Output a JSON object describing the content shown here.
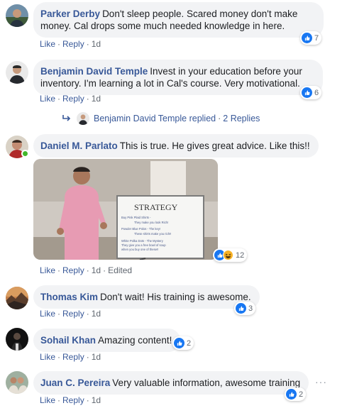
{
  "comments": [
    {
      "author": "Parker Derby",
      "text": "Don't sleep people. Scared money don't make money. Cal drops some much needed knowledge in here.",
      "actions": {
        "like": "Like",
        "reply": "Reply",
        "time": "1d"
      },
      "reactions": {
        "count": "7",
        "types": [
          "like-icon"
        ]
      }
    },
    {
      "author": "Benjamin David Temple",
      "text": "Invest in your education before your inventory. I'm learning a lot in Cal's course. Very motivational.",
      "actions": {
        "like": "Like",
        "reply": "Reply",
        "time": "1d"
      },
      "reactions": {
        "count": "6",
        "types": [
          "like-icon"
        ]
      },
      "replies": {
        "author": "Benjamin David Temple",
        "verb": "replied",
        "count_label": "2 Replies"
      }
    },
    {
      "author": "Daniel M. Parlato",
      "text": "This is true. He gives great advice. Like this!!",
      "actions": {
        "like": "Like",
        "reply": "Reply",
        "time": "1d",
        "edited": "Edited"
      },
      "reactions": {
        "count": "12",
        "types": [
          "like-icon",
          "haha-icon"
        ]
      },
      "photo": {
        "whiteboard_title": "STRATEGY",
        "whiteboard_lines": [
          "Buy Pink Plaid Shirts -",
          "They make you look Rich!",
          "Powder Blue Polos - The key!",
          "These shirts make you rich!!",
          "White Polka Dots - The Mystery",
          "They give you a free bowl of soup",
          "when you buy one of these!!"
        ]
      }
    },
    {
      "author": "Thomas Kim",
      "text": "Don't wait! His training is awesome.",
      "actions": {
        "like": "Like",
        "reply": "Reply",
        "time": "1d"
      },
      "reactions": {
        "count": "3",
        "types": [
          "like-icon"
        ]
      }
    },
    {
      "author": "Sohail Khan",
      "text": "Amazing content!",
      "actions": {
        "like": "Like",
        "reply": "Reply",
        "time": "1d"
      },
      "reactions": {
        "count": "2",
        "types": [
          "like-icon"
        ]
      }
    },
    {
      "author": "Juan C. Pereira",
      "text": "Very valuable information, awesome training",
      "actions": {
        "like": "Like",
        "reply": "Reply",
        "time": "1d"
      },
      "reactions": {
        "count": "2",
        "types": [
          "like-icon"
        ]
      }
    }
  ],
  "separator": "·",
  "more_icon": "···",
  "colors": {
    "link": "#385898",
    "bubble": "#f2f3f5",
    "like": "#1877f2",
    "online": "#42b72a"
  }
}
